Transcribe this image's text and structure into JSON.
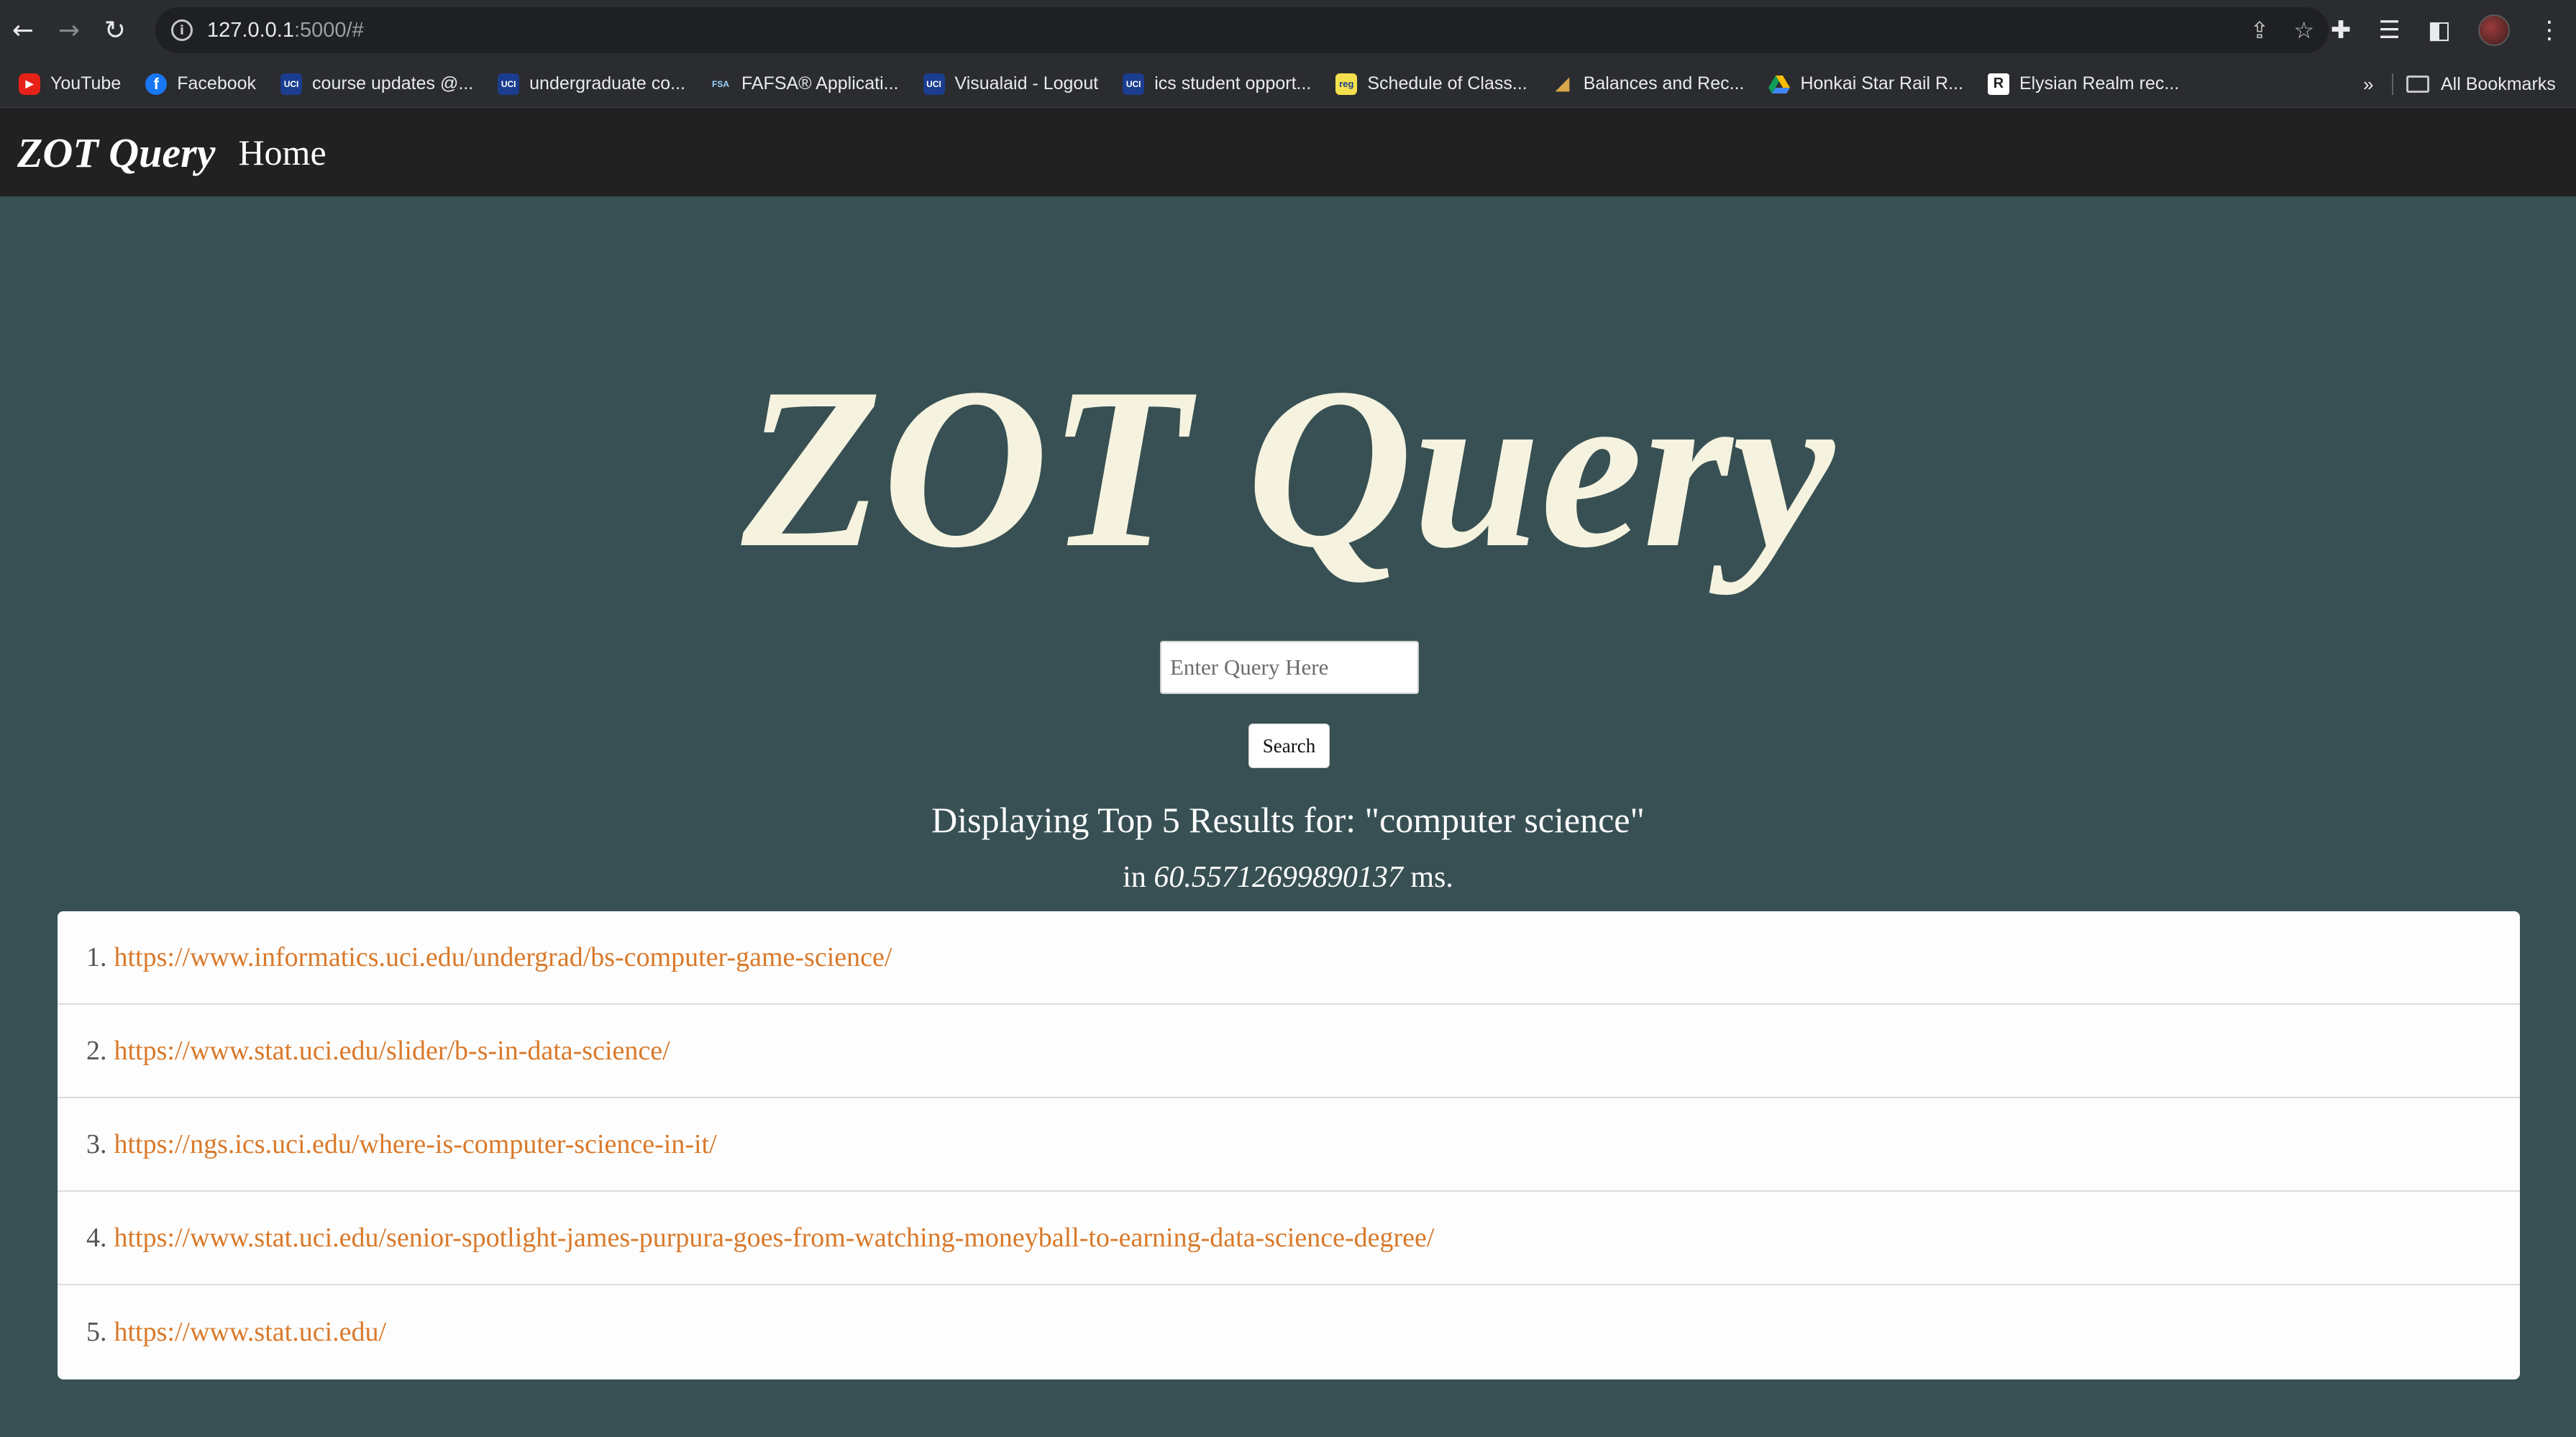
{
  "browser": {
    "url_host": "127.0.0.1",
    "url_rest": ":5000/#",
    "bookmarks": [
      {
        "label": "YouTube",
        "icon": "youtube-icon"
      },
      {
        "label": "Facebook",
        "icon": "facebook-icon"
      },
      {
        "label": "course updates @...",
        "icon": "uci-icon"
      },
      {
        "label": "undergraduate co...",
        "icon": "uci-icon"
      },
      {
        "label": "FAFSA® Applicati...",
        "icon": "fsa-icon"
      },
      {
        "label": "Visualaid - Logout",
        "icon": "uci-icon"
      },
      {
        "label": "ics student opport...",
        "icon": "uci-icon"
      },
      {
        "label": "Schedule of Class...",
        "icon": "reg-icon"
      },
      {
        "label": "Balances and Rec...",
        "icon": "balances-icon"
      },
      {
        "label": "Honkai Star Rail R...",
        "icon": "google-drive-icon"
      },
      {
        "label": "Elysian Realm rec...",
        "icon": "r-icon"
      }
    ],
    "bookmarks_more": "»",
    "all_bookmarks": "All Bookmarks"
  },
  "site": {
    "brand": "ZOT Query",
    "nav_home": "Home",
    "hero_title": "ZOT Query",
    "search_placeholder": "Enter Query Here",
    "search_button": "Search",
    "results_heading": "Displaying Top 5 Results for: \"computer science\"",
    "timing_prefix": "in",
    "timing_value": "60.55712699890137",
    "timing_suffix": "ms."
  },
  "results": [
    {
      "num": "1.",
      "url": "https://www.informatics.uci.edu/undergrad/bs-computer-game-science/"
    },
    {
      "num": "2.",
      "url": "https://www.stat.uci.edu/slider/b-s-in-data-science/"
    },
    {
      "num": "3.",
      "url": "https://ngs.ics.uci.edu/where-is-computer-science-in-it/"
    },
    {
      "num": "4.",
      "url": "https://www.stat.uci.edu/senior-spotlight-james-purpura-goes-from-watching-moneyball-to-earning-data-science-degree/"
    },
    {
      "num": "5.",
      "url": "https://www.stat.uci.edu/"
    }
  ],
  "colors": {
    "page_bg": "#385053",
    "nav_bg": "#212121",
    "hero_text": "#f5f3df",
    "link": "#d9792a"
  }
}
